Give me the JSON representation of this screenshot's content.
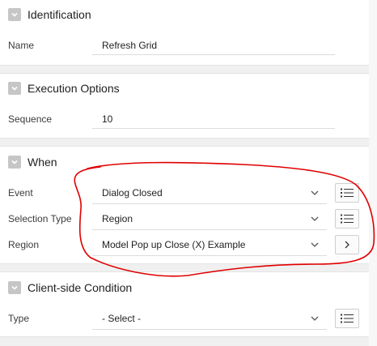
{
  "sections": {
    "identification": {
      "title": "Identification",
      "name_label": "Name",
      "name_value": "Refresh Grid"
    },
    "execution": {
      "title": "Execution Options",
      "sequence_label": "Sequence",
      "sequence_value": "10"
    },
    "when": {
      "title": "When",
      "event_label": "Event",
      "event_value": "Dialog Closed",
      "selection_type_label": "Selection Type",
      "selection_type_value": "Region",
      "region_label": "Region",
      "region_value": "Model Pop up Close (X) Example"
    },
    "condition": {
      "title": "Client-side Condition",
      "type_label": "Type",
      "type_value": "- Select -"
    }
  },
  "icons": {
    "section_toggle": "chevron-down-icon",
    "dropdown": "chevron-down-icon",
    "list_picker": "list-icon",
    "go_to": "chevron-right-icon"
  },
  "colors": {
    "annotation": "#e00000",
    "toggle": "#c6c6c6",
    "separator": "#f0f0f0"
  }
}
